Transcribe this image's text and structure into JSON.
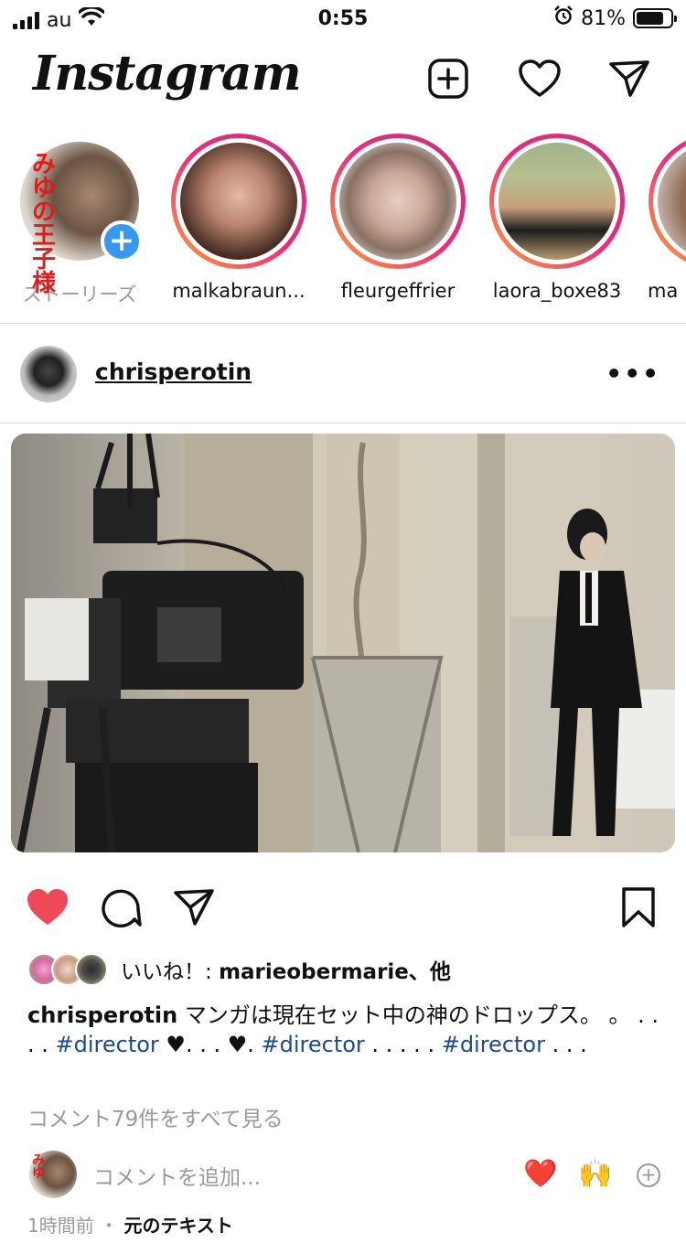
{
  "status_bar": {
    "carrier": "au",
    "time": "0:55",
    "battery": "81%",
    "battery_level": 0.81
  },
  "header": {
    "logo": "Instagram",
    "icons": [
      "new-post-icon",
      "heart-icon",
      "direct-message-icon"
    ]
  },
  "stories": [
    {
      "label": "ストーリーズ",
      "own": true,
      "badge": "みゆの王子様"
    },
    {
      "label": "malkabraun..."
    },
    {
      "label": "fleurgeffrier"
    },
    {
      "label": "laora_boxe83"
    },
    {
      "label": "ma"
    }
  ],
  "post": {
    "username": "chrisperotin",
    "more": "•••",
    "liked": true,
    "likes_prefix": "いいね！: ",
    "likes_user": "marieobermarie",
    "likes_suffix": "、他",
    "caption_user": "chrisperotin",
    "caption_parts": [
      " マンガは現在セット中の神のドロップス。 。 . . . . ",
      "#director",
      " ♥. . . ♥. ",
      "#director",
      " . . . . . ",
      "#director",
      " . . ."
    ],
    "view_comments": "コメント79件をすべて見る",
    "comment_placeholder": "コメントを追加...",
    "quick_emojis": [
      "❤️",
      "🙌"
    ],
    "time_ago": "1時間前",
    "separator": "・",
    "original_text": "元のテキスト"
  },
  "colors": {
    "like_red": "#ed4956",
    "hashtag_blue": "#1f4b8a",
    "story_gradient": [
      "#f9a33a",
      "#ee2a7b",
      "#c13584"
    ],
    "plus_blue": "#3897f0"
  }
}
